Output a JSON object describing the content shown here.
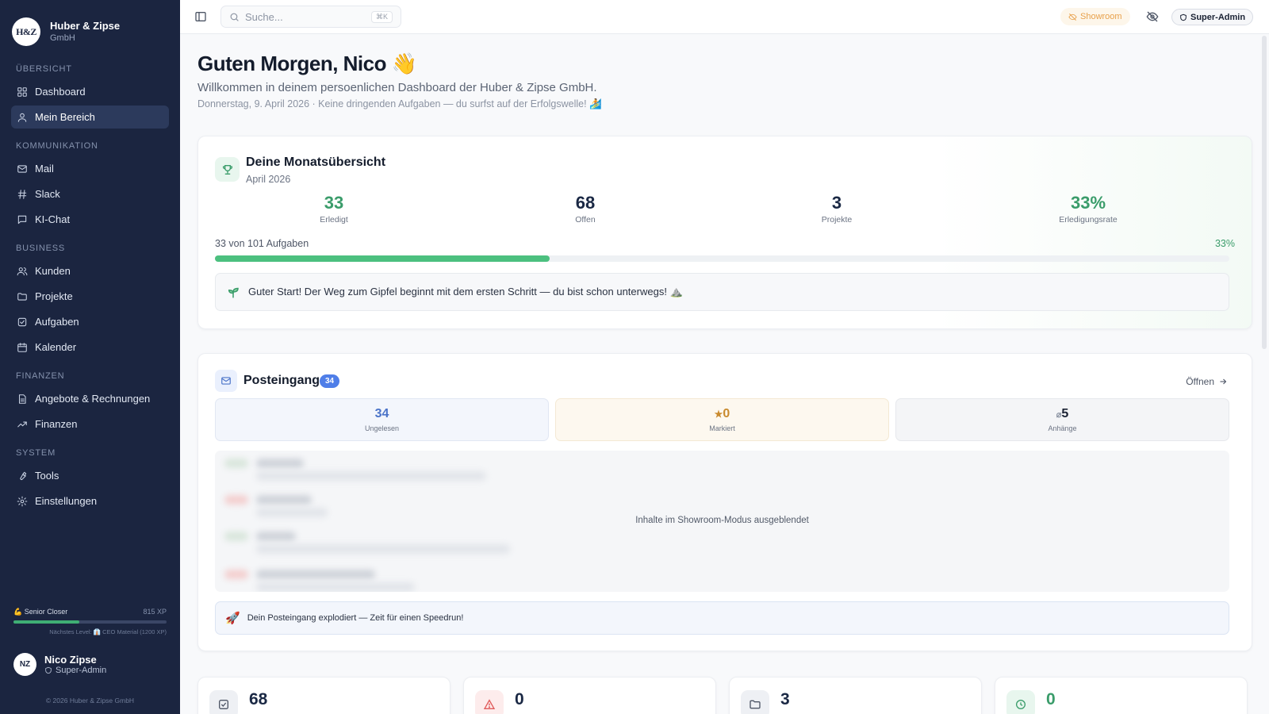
{
  "sidebar": {
    "brand_logo": "H&Z",
    "brand_name": "Huber & Zipse",
    "brand_sub": "GmbH",
    "sections": [
      {
        "title": "ÜBERSICHT",
        "items": [
          {
            "label": "Dashboard",
            "icon": "dashboard-icon",
            "active": false
          },
          {
            "label": "Mein Bereich",
            "icon": "user-icon",
            "active": true
          }
        ]
      },
      {
        "title": "KOMMUNIKATION",
        "items": [
          {
            "label": "Mail",
            "icon": "mail-icon",
            "active": false
          },
          {
            "label": "Slack",
            "icon": "hash-icon",
            "active": false
          },
          {
            "label": "KI-Chat",
            "icon": "chat-icon",
            "active": false
          }
        ]
      },
      {
        "title": "BUSINESS",
        "items": [
          {
            "label": "Kunden",
            "icon": "users-icon",
            "active": false
          },
          {
            "label": "Projekte",
            "icon": "folder-icon",
            "active": false
          },
          {
            "label": "Aufgaben",
            "icon": "checkbox-icon",
            "active": false
          },
          {
            "label": "Kalender",
            "icon": "calendar-icon",
            "active": false
          }
        ]
      },
      {
        "title": "FINANZEN",
        "items": [
          {
            "label": "Angebote & Rechnungen",
            "icon": "document-icon",
            "active": false
          },
          {
            "label": "Finanzen",
            "icon": "trend-up-icon",
            "active": false
          }
        ]
      },
      {
        "title": "SYSTEM",
        "items": [
          {
            "label": "Tools",
            "icon": "wrench-icon",
            "active": false
          },
          {
            "label": "Einstellungen",
            "icon": "gear-icon",
            "active": false
          }
        ]
      }
    ],
    "xp": {
      "level": "💪 Senior Closer",
      "value": "815 XP",
      "progress": 0.43,
      "next": "Nächstes Level: 👔 CEO Material (1200 XP)"
    },
    "user": {
      "initials": "NZ",
      "name": "Nico Zipse",
      "role": "Super-Admin"
    },
    "copyright": "© 2026 Huber & Zipse GmbH"
  },
  "topbar": {
    "search_placeholder": "Suche...",
    "search_shortcut": "⌘K",
    "showroom_label": "Showroom",
    "role_label": "Super-Admin"
  },
  "main": {
    "greeting": "Guten Morgen, Nico 👋",
    "welcome": "Willkommen in deinem persoenlichen Dashboard der Huber & Zipse GmbH.",
    "dateline": "Donnerstag, 9. April 2026 · Keine dringenden Aufgaben — du surfst auf der Erfolgswelle! 🏄"
  },
  "month": {
    "title": "Deine Monatsübersicht",
    "subtitle": "April 2026",
    "stats": [
      {
        "value": "33",
        "label": "Erledigt",
        "green": true
      },
      {
        "value": "68",
        "label": "Offen",
        "green": false
      },
      {
        "value": "3",
        "label": "Projekte",
        "green": false
      },
      {
        "value": "33%",
        "label": "Erledigungsrate",
        "green": true
      }
    ],
    "progress_label": "33 von 101 Aufgaben",
    "progress_pct": "33%",
    "progress": 0.33,
    "motivation": "Guter Start! Der Weg zum Gipfel beginnt mit dem ersten Schritt — du bist schon unterwegs! ⛰️"
  },
  "inbox": {
    "title": "Posteingang",
    "badge": "34",
    "open_label": "Öffnen",
    "unread": "34",
    "unread_label": "Ungelesen",
    "flagged": "0",
    "flagged_label": "Markiert",
    "attachments": "5",
    "attachments_label": "Anhänge",
    "hidden_text": "Inhalte im Showroom-Modus ausgeblendet",
    "speedrun": "Dein Posteingang explodiert — Zeit für einen Speedrun!"
  },
  "bottom_stats": [
    {
      "value": "68",
      "icon": "checkbox-icon",
      "color": "#1a2844",
      "bg": "#eef0f4"
    },
    {
      "value": "0",
      "icon": "warning-icon",
      "color": "#1a2844",
      "bg": "#fdecec"
    },
    {
      "value": "3",
      "icon": "folder-icon",
      "color": "#1a2844",
      "bg": "#eef0f4"
    },
    {
      "value": "0",
      "icon": "clock-icon",
      "color": "#3a9c6a",
      "bg": "#e8f6ee"
    }
  ]
}
